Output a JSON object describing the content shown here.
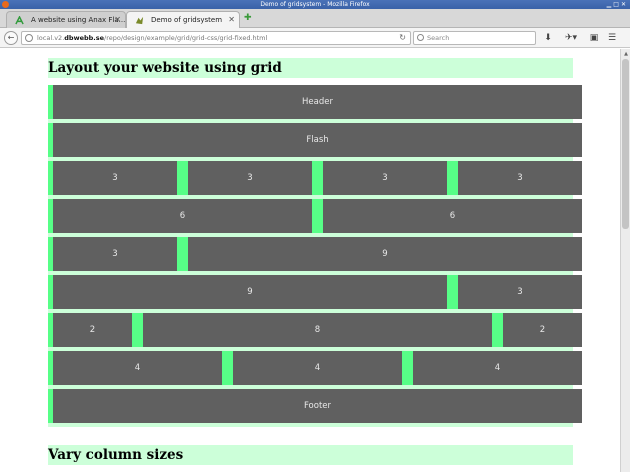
{
  "window": {
    "title": "Demo of gridsystem - Mozilla Firefox"
  },
  "tabs": [
    {
      "label": "A website using Anax Fla..."
    },
    {
      "label": "Demo of gridsystem"
    }
  ],
  "navbar": {
    "url_prefix": "local.v2.",
    "url_domain": "dbwebb.se",
    "url_path": "/repo/design/example/grid/grid-css/grid-fixed.html",
    "search_placeholder": "Search"
  },
  "page": {
    "heading": "Layout your website using grid",
    "second_heading": "Vary column sizes",
    "rows": [
      {
        "cells": [
          {
            "label": "Header",
            "span": 12
          }
        ]
      },
      {
        "cells": [
          {
            "label": "Flash",
            "span": 12
          }
        ]
      },
      {
        "cells": [
          {
            "label": "3",
            "span": 3
          },
          {
            "label": "3",
            "span": 3
          },
          {
            "label": "3",
            "span": 3
          },
          {
            "label": "3",
            "span": 3
          }
        ]
      },
      {
        "cells": [
          {
            "label": "6",
            "span": 6
          },
          {
            "label": "6",
            "span": 6
          }
        ]
      },
      {
        "cells": [
          {
            "label": "3",
            "span": 3
          },
          {
            "label": "9",
            "span": 9
          }
        ]
      },
      {
        "cells": [
          {
            "label": "9",
            "span": 9
          },
          {
            "label": "3",
            "span": 3
          }
        ]
      },
      {
        "cells": [
          {
            "label": "2",
            "span": 2
          },
          {
            "label": "8",
            "span": 8
          },
          {
            "label": "2",
            "span": 2
          }
        ]
      },
      {
        "cells": [
          {
            "label": "4",
            "span": 4
          },
          {
            "label": "4",
            "span": 4
          },
          {
            "label": "4",
            "span": 4
          }
        ]
      },
      {
        "cells": [
          {
            "label": "Footer",
            "span": 12
          }
        ]
      }
    ]
  },
  "colors": {
    "grid_background": "#ccffd9",
    "gutter": "#57ff87",
    "cell": "#606060",
    "cell_text": "#e8e8e8"
  }
}
